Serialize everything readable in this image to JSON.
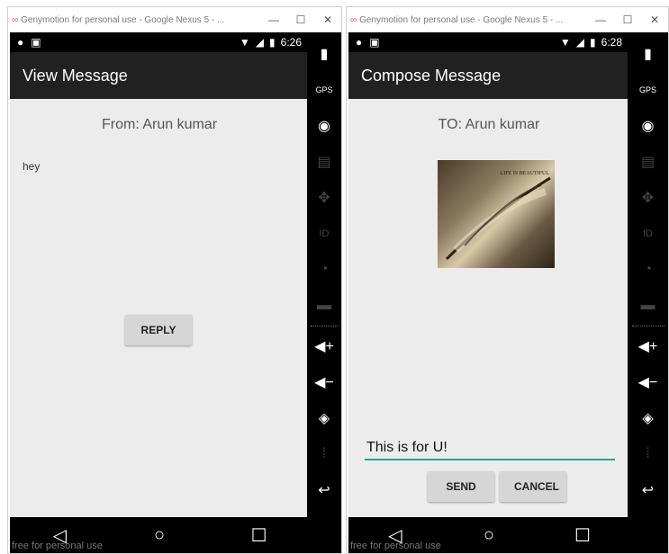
{
  "left_window": {
    "title": "Genymotion for personal use - Google Nexus 5 - ...",
    "minimize": "—",
    "maximize": "☐",
    "close": "✕",
    "status_time": "6:26",
    "action_title": "View Message",
    "from_text": "From: Arun kumar",
    "message_text": "hey",
    "reply_label": "REPLY",
    "watermark": "free for personal use"
  },
  "right_window": {
    "title": "Genymotion for personal use - Google Nexus 5 - ...",
    "minimize": "—",
    "maximize": "☐",
    "close": "✕",
    "status_time": "6:28",
    "action_title": "Compose Message",
    "to_text": "TO: Arun kumar",
    "photo_caption": "LIFE IS BEAUTIFUL",
    "input_value": "This is for U!",
    "send_label": "SEND",
    "cancel_label": "CANCEL",
    "watermark": "free for personal use"
  },
  "sidebar_icons": [
    "battery-icon",
    "gps-icon",
    "webcam-icon",
    "capture-icon",
    "dpad-icon",
    "id-icon",
    "rss-icon",
    "sms-icon",
    "volume-up-icon",
    "volume-down-icon",
    "rotate-icon",
    "pixel-icon",
    "back-arrow-icon"
  ],
  "gps_label": "GPS",
  "id_label": "ID",
  "colors": {
    "accent": "#26a69a",
    "actionbar": "#212121",
    "background": "#ececec"
  }
}
